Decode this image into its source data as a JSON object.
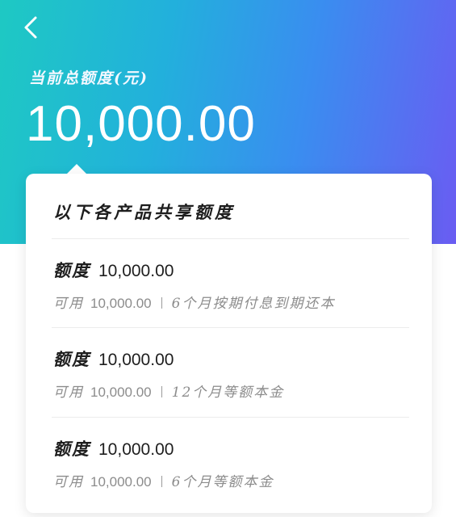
{
  "header": {
    "back_icon": "chevron-left-icon",
    "label": "当前总额度(元)",
    "amount": "10,000.00",
    "gradient_colors": [
      "#1ec9c3",
      "#3a8df0",
      "#6a5cf2"
    ]
  },
  "card": {
    "title": "以下各产品共享额度",
    "items": [
      {
        "quota_label": "额度",
        "quota_value": "10,000.00",
        "avail_label": "可用",
        "avail_value": "10,000.00",
        "desc": "6个月按期付息到期还本"
      },
      {
        "quota_label": "额度",
        "quota_value": "10,000.00",
        "avail_label": "可用",
        "avail_value": "10,000.00",
        "desc": "12个月等额本金"
      },
      {
        "quota_label": "额度",
        "quota_value": "10,000.00",
        "avail_label": "可用",
        "avail_value": "10,000.00",
        "desc": "6个月等额本金"
      }
    ]
  }
}
